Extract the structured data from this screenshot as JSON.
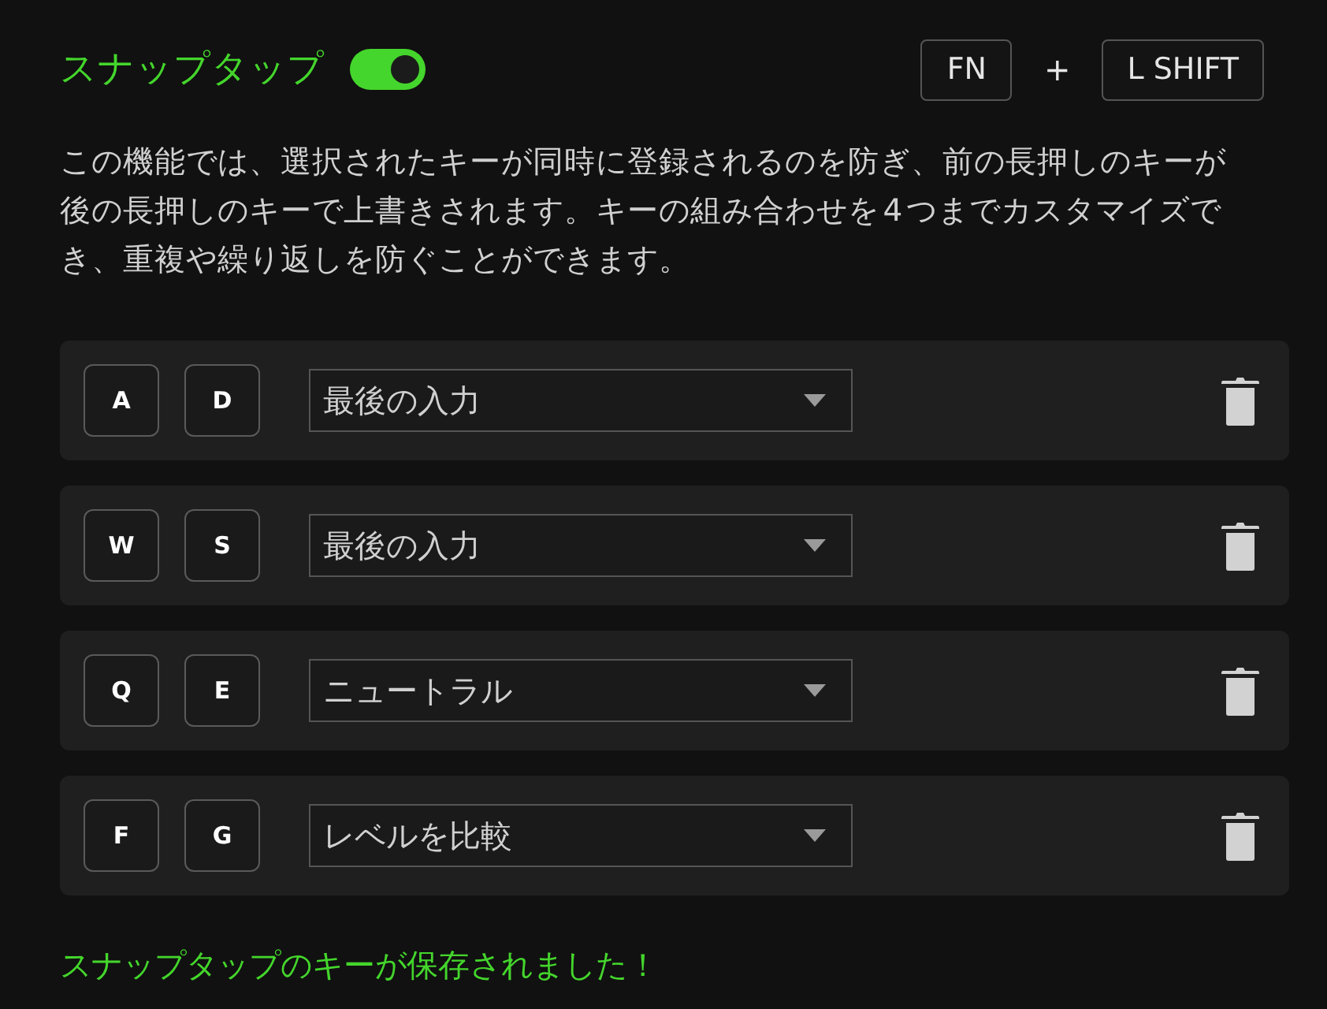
{
  "header": {
    "title": "スナップタップ",
    "toggle": {
      "on": true
    },
    "shortcut": {
      "keys": [
        "FN",
        "L SHIFT"
      ],
      "separator": "+"
    }
  },
  "description": "この機能では、選択されたキーが同時に登録されるのを防ぎ、前の長押しのキーが後の長押しのキーで上書きされます。キーの組み合わせを 4 つまでカスタマイズでき、重複や繰り返しを防ぐことができます。",
  "bindings": [
    {
      "keys": [
        "A",
        "D"
      ],
      "mode": "最後の入力"
    },
    {
      "keys": [
        "W",
        "S"
      ],
      "mode": "最後の入力"
    },
    {
      "keys": [
        "Q",
        "E"
      ],
      "mode": "ニュートラル"
    },
    {
      "keys": [
        "F",
        "G"
      ],
      "mode": "レベルを比較"
    }
  ],
  "status_message": "スナップタップのキーが保存されました！"
}
